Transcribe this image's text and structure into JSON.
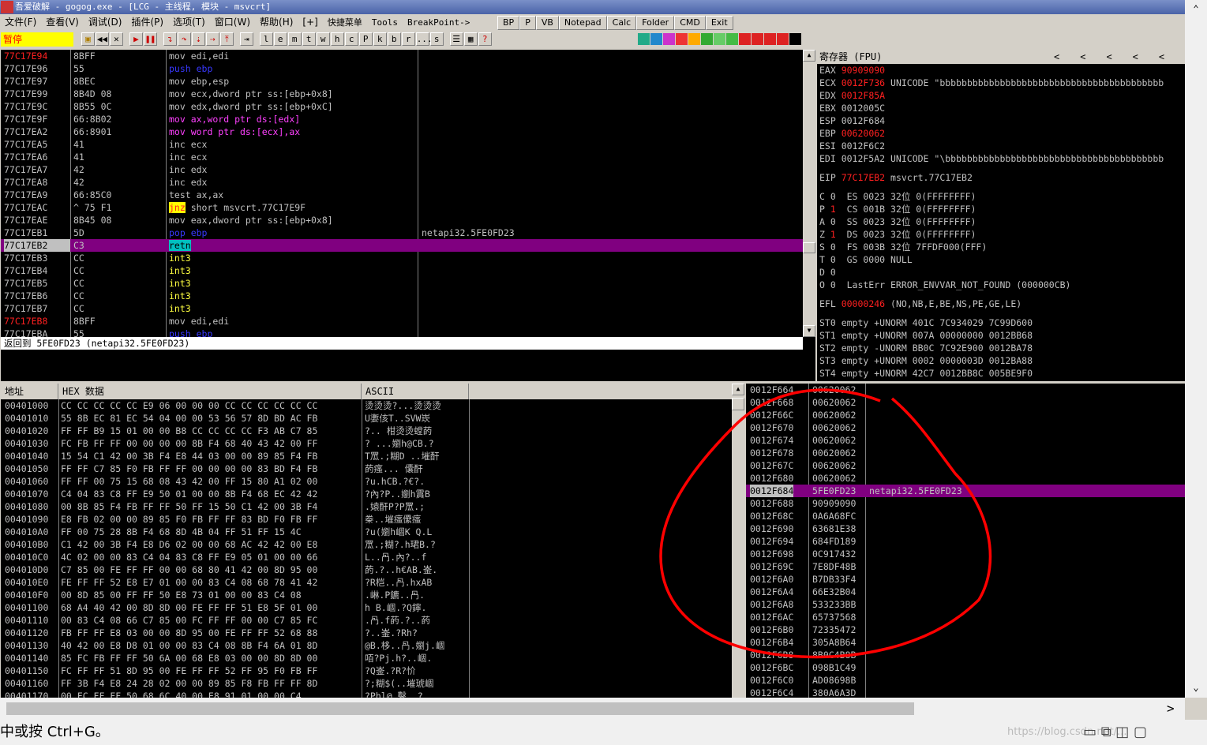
{
  "window": {
    "title": "吾爱破解 - gogog.exe - [LCG - 主线程, 模块 - msvcrt]"
  },
  "menu": {
    "items": [
      "文件(F)",
      "查看(V)",
      "调试(D)",
      "插件(P)",
      "选项(T)",
      "窗口(W)",
      "帮助(H)",
      "[+]",
      "快捷菜单",
      "Tools",
      "BreakPoint->"
    ],
    "buttons": [
      "BP",
      "P",
      "VB",
      "Notepad",
      "Calc",
      "Folder",
      "CMD",
      "Exit"
    ]
  },
  "toolbar": {
    "status": "暂停",
    "letters": [
      "l",
      "e",
      "m",
      "t",
      "w",
      "h",
      "c",
      "P",
      "k",
      "b",
      "r",
      "...",
      "s"
    ]
  },
  "cpu": {
    "rows": [
      {
        "addr": "77C17E94",
        "bytes": "8BFF",
        "dis": [
          [
            "mov edi,edi",
            "grn"
          ]
        ],
        "comment": "",
        "addr_red": true
      },
      {
        "addr": "77C17E96",
        "bytes": "55",
        "dis": [
          [
            "push ebp",
            "blu"
          ]
        ],
        "comment": ""
      },
      {
        "addr": "77C17E97",
        "bytes": "8BEC",
        "dis": [
          [
            "mov ebp,esp",
            "grn"
          ]
        ],
        "comment": ""
      },
      {
        "addr": "77C17E99",
        "bytes": "8B4D 08",
        "dis": [
          [
            "mov ecx,dword ptr ss:[ebp+0x8]",
            "grn"
          ]
        ],
        "comment": ""
      },
      {
        "addr": "77C17E9C",
        "bytes": "8B55 0C",
        "dis": [
          [
            "mov edx,dword ptr ss:[ebp+0xC]",
            "grn"
          ]
        ],
        "comment": ""
      },
      {
        "addr": "77C17E9F",
        "bytes": "66:8B02",
        "dis": [
          [
            "mov ax,word ptr ds:[edx]",
            "mag"
          ]
        ],
        "comment": ""
      },
      {
        "addr": "77C17EA2",
        "bytes": "66:8901",
        "dis": [
          [
            "mov word ptr ds:[ecx],ax",
            "mag"
          ]
        ],
        "comment": ""
      },
      {
        "addr": "77C17EA5",
        "bytes": "41",
        "dis": [
          [
            "inc ecx",
            "grn"
          ]
        ],
        "comment": ""
      },
      {
        "addr": "77C17EA6",
        "bytes": "41",
        "dis": [
          [
            "inc ecx",
            "grn"
          ]
        ],
        "comment": ""
      },
      {
        "addr": "77C17EA7",
        "bytes": "42",
        "dis": [
          [
            "inc edx",
            "grn"
          ]
        ],
        "comment": ""
      },
      {
        "addr": "77C17EA8",
        "bytes": "42",
        "dis": [
          [
            "inc edx",
            "grn"
          ]
        ],
        "comment": ""
      },
      {
        "addr": "77C17EA9",
        "bytes": "66:85C0",
        "dis": [
          [
            "test ax,ax",
            "grn"
          ]
        ],
        "comment": ""
      },
      {
        "addr": "77C17EAC",
        "bytes": "^ 75 F1",
        "dis": [
          [
            "jnz short msvcrt.77C17E9F",
            "jmp"
          ]
        ],
        "comment": ""
      },
      {
        "addr": "77C17EAE",
        "bytes": "8B45 08",
        "dis": [
          [
            "mov eax,dword ptr ss:[ebp+0x8]",
            "grn"
          ]
        ],
        "comment": ""
      },
      {
        "addr": "77C17EB1",
        "bytes": "5D",
        "dis": [
          [
            "pop ebp",
            "blu"
          ]
        ],
        "comment": "netapi32.5FE0FD23"
      },
      {
        "addr": "77C17EB2",
        "bytes": "C3",
        "dis": [
          [
            "retn",
            "ret"
          ]
        ],
        "comment": "",
        "current": true
      },
      {
        "addr": "77C17EB3",
        "bytes": "CC",
        "dis": [
          [
            "int3",
            "yel"
          ]
        ],
        "comment": ""
      },
      {
        "addr": "77C17EB4",
        "bytes": "CC",
        "dis": [
          [
            "int3",
            "yel"
          ]
        ],
        "comment": ""
      },
      {
        "addr": "77C17EB5",
        "bytes": "CC",
        "dis": [
          [
            "int3",
            "yel"
          ]
        ],
        "comment": ""
      },
      {
        "addr": "77C17EB6",
        "bytes": "CC",
        "dis": [
          [
            "int3",
            "yel"
          ]
        ],
        "comment": ""
      },
      {
        "addr": "77C17EB7",
        "bytes": "CC",
        "dis": [
          [
            "int3",
            "yel"
          ]
        ],
        "comment": ""
      },
      {
        "addr": "77C17EB8",
        "bytes": "8BFF",
        "dis": [
          [
            "mov edi,edi",
            "grn"
          ]
        ],
        "comment": "",
        "addr_red": true
      },
      {
        "addr": "77C17EBA",
        "bytes": "55",
        "dis": [
          [
            "push ebp",
            "blu"
          ]
        ],
        "comment": ""
      }
    ]
  },
  "info": {
    "text": "返回到 5FE0FD23 (netapi32.5FE0FD23)"
  },
  "registers": {
    "header": "寄存器 (FPU)",
    "lines": [
      [
        [
          "EAX ",
          ""
        ],
        [
          "90909090",
          "red"
        ]
      ],
      [
        [
          "ECX ",
          ""
        ],
        [
          "0012F736",
          "red"
        ],
        [
          " UNICODE \"bbbbbbbbbbbbbbbbbbbbbbbbbbbbbbbbbbbbbbbbb",
          ""
        ]
      ],
      [
        [
          "EDX ",
          ""
        ],
        [
          "0012F85A",
          "red"
        ]
      ],
      [
        [
          "EBX 0012005C",
          ""
        ]
      ],
      [
        [
          "ESP 0012F684",
          ""
        ]
      ],
      [
        [
          "EBP ",
          ""
        ],
        [
          "00620062",
          "red"
        ]
      ],
      [
        [
          "ESI 0012F6C2",
          ""
        ]
      ],
      [
        [
          "EDI 0012F5A2 UNICODE \"\\bbbbbbbbbbbbbbbbbbbbbbbbbbbbbbbbbbbbbbbb",
          ""
        ]
      ],
      [
        [
          "",
          ""
        ]
      ],
      [
        [
          "EIP ",
          ""
        ],
        [
          "77C17EB2",
          "red"
        ],
        [
          " msvcrt.77C17EB2",
          ""
        ]
      ],
      [
        [
          "",
          ""
        ]
      ],
      [
        [
          "C 0  ES 0023 32位 0(FFFFFFFF)",
          ""
        ]
      ],
      [
        [
          "P ",
          ""
        ],
        [
          "1",
          "red"
        ],
        [
          "  CS 001B 32位 0(FFFFFFFF)",
          ""
        ]
      ],
      [
        [
          "A 0  SS 0023 32位 0(FFFFFFFF)",
          ""
        ]
      ],
      [
        [
          "Z ",
          ""
        ],
        [
          "1",
          "red"
        ],
        [
          "  DS 0023 32位 0(FFFFFFFF)",
          ""
        ]
      ],
      [
        [
          "S 0  FS 003B 32位 7FFDF000(FFF)",
          ""
        ]
      ],
      [
        [
          "T 0  GS 0000 NULL",
          ""
        ]
      ],
      [
        [
          "D 0",
          ""
        ]
      ],
      [
        [
          "O 0  LastErr ERROR_ENVVAR_NOT_FOUND (000000CB)",
          ""
        ]
      ],
      [
        [
          "",
          ""
        ]
      ],
      [
        [
          "EFL ",
          ""
        ],
        [
          "00000246",
          "red"
        ],
        [
          " (NO,NB,E,BE,NS,PE,GE,LE)",
          ""
        ]
      ],
      [
        [
          "",
          ""
        ]
      ],
      [
        [
          "ST0 empty +UNORM 401C 7C934029 7C99D600",
          ""
        ]
      ],
      [
        [
          "ST1 empty +UNORM 007A 00000000 0012BB68",
          ""
        ]
      ],
      [
        [
          "ST2 empty -UNORM BB0C 7C92E900 0012BA78",
          ""
        ]
      ],
      [
        [
          "ST3 empty +UNORM 0002 0000003D 0012BA88",
          ""
        ]
      ],
      [
        [
          "ST4 empty +UNORM 42C7 0012BB8C 005BE9F0",
          ""
        ]
      ]
    ]
  },
  "dump": {
    "headers": [
      "地址",
      "HEX 数据",
      "ASCII"
    ],
    "rows": [
      [
        "00401000",
        "CC CC CC CC CC E9 06 00 00 00 CC CC CC CC CC CC",
        "烫烫烫?...烫烫烫"
      ],
      [
        "00401010",
        "55 8B EC 81 EC 54 04 00 00 53 56 57 8D BD AC FB",
        "U嬱侅T..SVW崁"
      ],
      [
        "00401020",
        "FF FF B9 15 01 00 00 B8 CC CC CC CC F3 AB C7 85",
        "?.. 柑烫烫螳菂"
      ],
      [
        "00401030",
        "FC FB FF FF 00 00 00 00 8B F4 68 40 43 42 00 FF",
        "? ...嬼h@CB.?"
      ],
      [
        "00401040",
        "15 54 C1 42 00 3B F4 E8 44 03 00 00 89 85 F4 FB",
        "T罛.;糊D ..墔酐"
      ],
      [
        "00401050",
        "FF FF C7 85 F0 FB FF FF 00 00 00 00 83 BD F4 FB",
        "菂瘙... 儾酐"
      ],
      [
        "00401060",
        "FF FF 00 75 15 68 08 43 42 00 FF 15 80 A1 02 00",
        "?u.hCB.?€?."
      ],
      [
        "00401070",
        "C4 04 83 C8 FF E9 50 01 00 00 8B F4 68 EC 42 42",
        "?內?P..嬼h霣B"
      ],
      [
        "00401080",
        "00 8B 85 F4 FB FF FF 50 FF 15 50 C1 42 00 3B F4",
        ".媴酐P?P罛.;"
      ],
      [
        "00401090",
        "E8 FB 02 00 00 89 85 F0 FB FF FF 83 BD F0 FB FF",
        "桊..墔瘙儽瘙"
      ],
      [
        "004010A0",
        "FF 00 75 28 8B F4 68 8D 4B 04 FF 51 FF 15 4C",
        "?u(嬼h崓K Q.L"
      ],
      [
        "004010B0",
        "C1 42 00 3B F4 E8 D6 02 00 00 68 AC 42 42 00 E8",
        "罛.;糊?.h珺B.?"
      ],
      [
        "004010C0",
        "4C 02 00 00 83 C4 04 83 C8 FF E9 05 01 00 00 66",
        "L..冎.內?..f"
      ],
      [
        "004010D0",
        "C7 85 00 FE FF FF 00 00 68 80 41 42 00 8D 95 00",
        "菂.?..h€AB.崟."
      ],
      [
        "004010E0",
        "FE FF FF 52 E8 E7 01 00 00 83 C4 08 68 78 41 42",
        "?R桤..冎.hxAB"
      ],
      [
        "004010F0",
        "00 8D 85 00 FF FF 50 E8 73 01 00 00 83 C4 08",
        ".崊.P鑣..冎."
      ],
      [
        "00401100",
        "68 A4 40 42 00 8D 8D 00 FE FF FF 51 E8 5F 01 00",
        "h B.崓.?Q鑏."
      ],
      [
        "00401110",
        "00 83 C4 08 66 C7 85 00 FC FF FF 00 00 C7 85 FC",
        ".冎.f菂.?..菂"
      ],
      [
        "00401120",
        "FB FF FF E8 03 00 00 8D 95 00 FE FF FF 52 68 88",
        "?..崟.?Rh?"
      ],
      [
        "00401130",
        "40 42 00 E8 D8 01 00 00 83 C4 08 8B F4 6A 01 8D",
        "@B.栘..冎.嬼j.崓"
      ],
      [
        "00401140",
        "85 FC FB FF FF 50 6A 00 68 E8 03 00 00 8D 8D 00",
        "咟?Pj.h?..崓."
      ],
      [
        "00401150",
        "FC FF FF 51 8D 95 00 FE FF FF 52 FF 95 F0 FB FF",
        "?Q崟.?R?忦"
      ],
      [
        "00401160",
        "FF 3B F4 E8 24 28 02 00 00 89 85 F8 FB FF FF 8D",
        "?;糊$(..墔琥崓"
      ],
      [
        "00401170",
        "00 FC FF FF 50 68 6C 40 00 E8 91 01 00 00 C4",
        "?Phl@.鑿..?"
      ]
    ]
  },
  "stack": {
    "rows": [
      [
        "0012F664",
        "00620062",
        ""
      ],
      [
        "0012F668",
        "00620062",
        ""
      ],
      [
        "0012F66C",
        "00620062",
        ""
      ],
      [
        "0012F670",
        "00620062",
        ""
      ],
      [
        "0012F674",
        "00620062",
        ""
      ],
      [
        "0012F678",
        "00620062",
        ""
      ],
      [
        "0012F67C",
        "00620062",
        ""
      ],
      [
        "0012F680",
        "00620062",
        ""
      ],
      [
        "0012F684",
        "5FE0FD23",
        "netapi32.5FE0FD23"
      ],
      [
        "0012F688",
        "90909090",
        ""
      ],
      [
        "0012F68C",
        "0A6A68FC",
        ""
      ],
      [
        "0012F690",
        "63681E38",
        ""
      ],
      [
        "0012F694",
        "684FD189",
        ""
      ],
      [
        "0012F698",
        "0C917432",
        ""
      ],
      [
        "0012F69C",
        "7E8DF48B",
        ""
      ],
      [
        "0012F6A0",
        "B7DB33F4",
        ""
      ],
      [
        "0012F6A4",
        "66E32B04",
        ""
      ],
      [
        "0012F6A8",
        "533233BB",
        ""
      ],
      [
        "0012F6AC",
        "65737568",
        ""
      ],
      [
        "0012F6B0",
        "72335472",
        ""
      ],
      [
        "0012F6B4",
        "305A8B64",
        ""
      ],
      [
        "0012F6B8",
        "8B0C4B8B",
        ""
      ],
      [
        "0012F6BC",
        "098B1C49",
        ""
      ],
      [
        "0012F6C0",
        "AD08698B",
        ""
      ],
      [
        "0012F6C4",
        "380A6A3D",
        ""
      ]
    ]
  },
  "statusbar": {
    "text": "中或按 Ctrl+G。",
    "watermark": "https://blog.csdn.net/..."
  },
  "colors": {
    "annotation": "#ff0000",
    "current_row": "#800080",
    "background": "#000000"
  }
}
